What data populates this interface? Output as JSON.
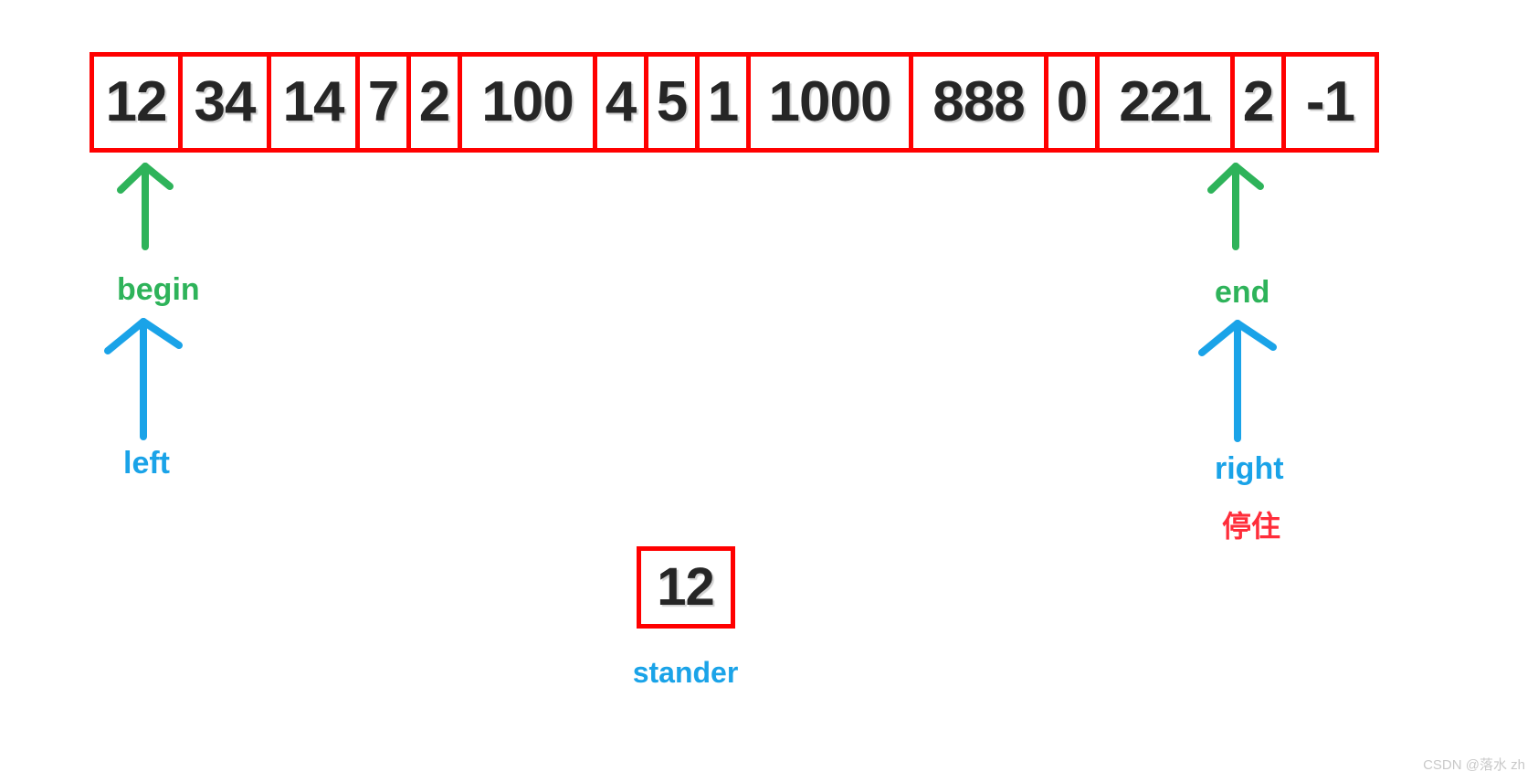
{
  "diagram": {
    "title": "quicksort-hoare-partition-illustration",
    "colors": {
      "cell_border": "#ff0000",
      "value_text": "#262626",
      "begin_end_arrow": "#2eb35a",
      "left_right_arrow": "#1aa3e8",
      "stop_text": "#ff2d3a",
      "background": "#ffffff",
      "watermark": "#c9c9c9"
    },
    "array": {
      "name": "data-array",
      "cells": [
        {
          "value": "12",
          "digits": 2
        },
        {
          "value": "34",
          "digits": 2
        },
        {
          "value": "14",
          "digits": 2
        },
        {
          "value": "7",
          "digits": 1
        },
        {
          "value": "2",
          "digits": 1
        },
        {
          "value": "100",
          "digits": 3
        },
        {
          "value": "4",
          "digits": 1
        },
        {
          "value": "5",
          "digits": 1
        },
        {
          "value": "1",
          "digits": 1
        },
        {
          "value": "1000",
          "digits": 4
        },
        {
          "value": "888",
          "digits": 3
        },
        {
          "value": "0",
          "digits": 1
        },
        {
          "value": "221",
          "digits": 3
        },
        {
          "value": "2",
          "digits": 1
        },
        {
          "value": "-1",
          "digits": 2
        }
      ]
    },
    "pointers": {
      "begin": {
        "label": "begin",
        "color": "#2eb35a",
        "arrow": "up-arrow-icon"
      },
      "end": {
        "label": "end",
        "color": "#2eb35a",
        "arrow": "up-arrow-icon"
      },
      "left": {
        "label": "left",
        "color": "#1aa3e8",
        "arrow": "up-arrow-icon"
      },
      "right": {
        "label": "right",
        "color": "#1aa3e8",
        "arrow": "up-arrow-icon"
      }
    },
    "annotations": {
      "stop_note": "停住"
    },
    "stander": {
      "label": "stander",
      "value": "12"
    },
    "watermark": "CSDN @落水 zh"
  }
}
